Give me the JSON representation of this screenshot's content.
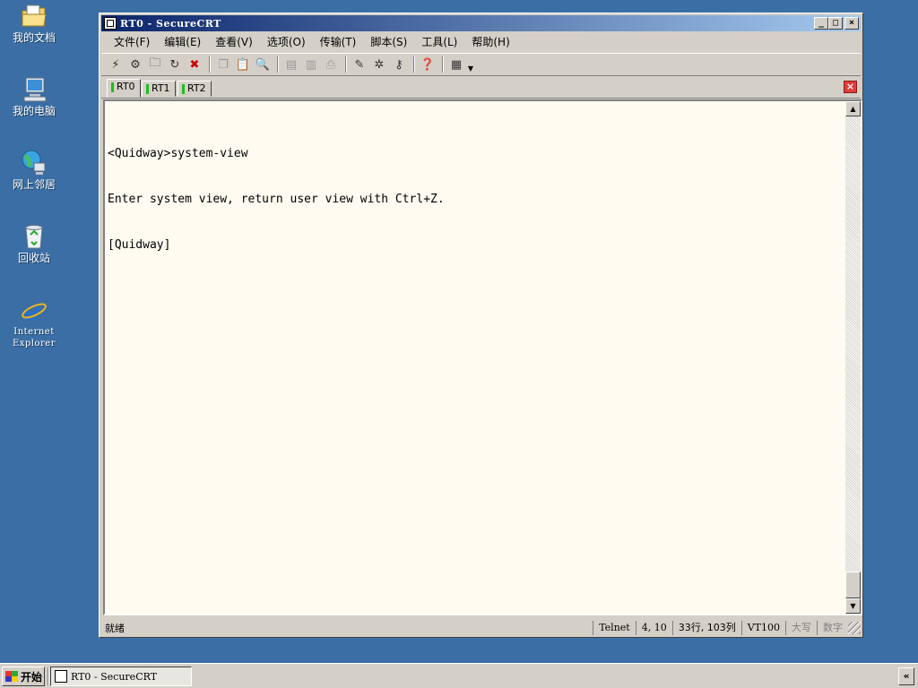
{
  "desktop": {
    "icons": [
      {
        "label": "我的文档",
        "icon": "my-documents-icon"
      },
      {
        "label": "我的电脑",
        "icon": "my-computer-icon"
      },
      {
        "label": "网上邻居",
        "icon": "network-places-icon"
      },
      {
        "label": "回收站",
        "icon": "recycle-bin-icon"
      },
      {
        "label_line1": "Internet",
        "label_line2": "Explorer",
        "icon": "internet-explorer-icon"
      }
    ]
  },
  "window": {
    "title": "RT0 - SecureCRT",
    "controls": {
      "minimize": "_",
      "maximize": "□",
      "close": "×"
    }
  },
  "menubar": {
    "items": [
      "文件(F)",
      "编辑(E)",
      "查看(V)",
      "选项(O)",
      "传输(T)",
      "脚本(S)",
      "工具(L)",
      "帮助(H)"
    ]
  },
  "tabs": [
    {
      "label": "RT0",
      "active": true
    },
    {
      "label": "RT1",
      "active": false
    },
    {
      "label": "RT2",
      "active": false
    }
  ],
  "terminal": {
    "lines": [
      "<Quidway>system-view",
      "Enter system view, return user view with Ctrl+Z.",
      "[Quidway]"
    ]
  },
  "statusbar": {
    "ready": "就绪",
    "protocol": "Telnet",
    "cursor_pos": "4,  10",
    "size": "33行, 103列",
    "emulation": "VT100",
    "caps": "大写",
    "num": "数字"
  },
  "taskbar": {
    "start_label": "开始",
    "task_label": "RT0 - SecureCRT",
    "tray_label": "«"
  }
}
